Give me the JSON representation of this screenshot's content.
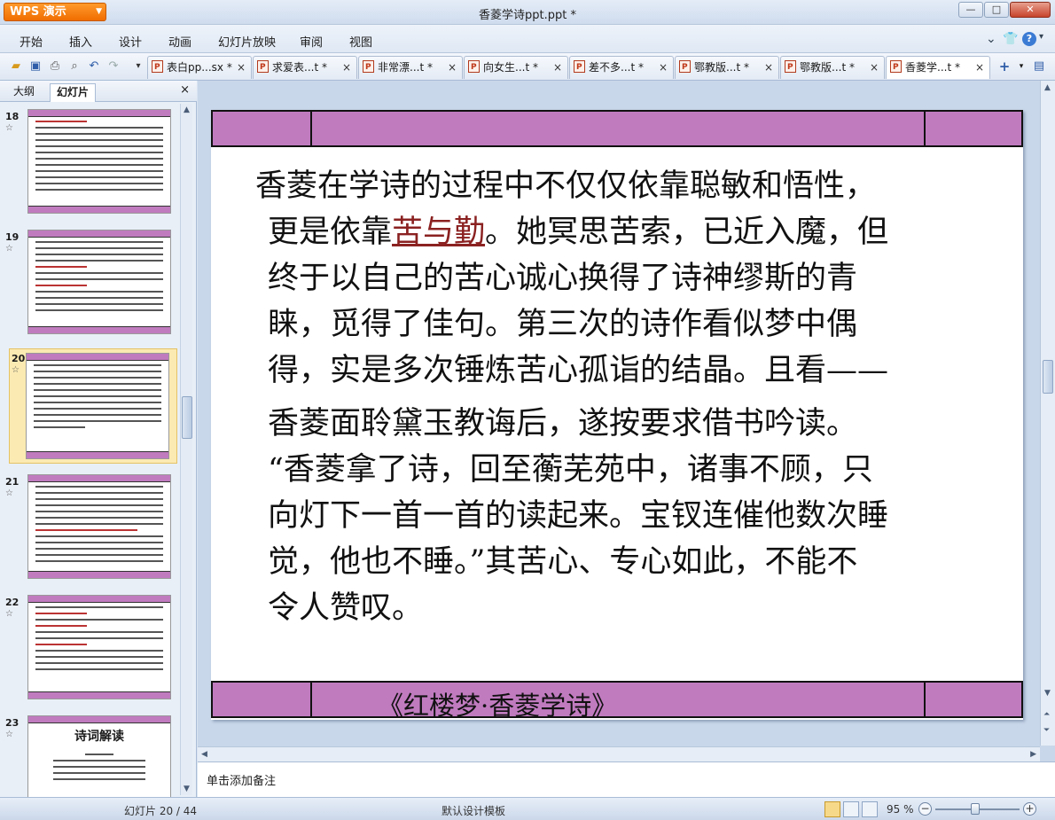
{
  "app": {
    "logo_label": "WPS 演示",
    "title": "香菱学诗ppt.ppt *"
  },
  "window_controls": {
    "minimize": "—",
    "maximize": "□",
    "close": "✕"
  },
  "menu": [
    "开始",
    "插入",
    "设计",
    "动画",
    "幻灯片放映",
    "审阅",
    "视图"
  ],
  "menu_right": {
    "dropdown": "⌄",
    "skin": "👕",
    "help": "?"
  },
  "toolbar_icons": [
    "folder-open-icon",
    "save-icon",
    "print-icon",
    "print-preview-icon",
    "undo-icon",
    "redo-icon",
    "customize-icon"
  ],
  "doc_tabs": [
    {
      "label": "表白pp...sx *"
    },
    {
      "label": "求爱表...t *"
    },
    {
      "label": "非常漂...t *"
    },
    {
      "label": "向女生...t *"
    },
    {
      "label": "差不多...t *"
    },
    {
      "label": "鄂教版...t *"
    },
    {
      "label": "鄂教版...t *"
    },
    {
      "label": "香菱学...t *"
    }
  ],
  "tab_close": "×",
  "new_tab": "+",
  "left_panel": {
    "tabs": [
      "大纲",
      "幻灯片"
    ],
    "close": "×",
    "slides": [
      {
        "number": "18",
        "star": "☆"
      },
      {
        "number": "19",
        "star": "☆"
      },
      {
        "number": "20",
        "star": "☆",
        "selected": true
      },
      {
        "number": "21",
        "star": "☆"
      },
      {
        "number": "22",
        "star": "☆"
      },
      {
        "number": "23",
        "star": "☆",
        "title": "诗词解读"
      }
    ]
  },
  "slide": {
    "lines": [
      {
        "text": "香菱在学诗的过程中不仅仅依靠聪敏和悟性，",
        "indent": false
      },
      {
        "before": "更是依靠",
        "keyword": "苦与勤",
        "after": "。她冥思苦索，已近入魔，但",
        "indent": true
      },
      {
        "text": "终于以自己的苦心诚心换得了诗神缪斯的青",
        "indent": true
      },
      {
        "text": "睐，觅得了佳句。第三次的诗作看似梦中偶",
        "indent": true
      },
      {
        "text": "得，实是多次锤炼苦心孤诣的结晶。且看——",
        "indent": true
      },
      {
        "text": "香菱面聆黛玉教诲后，遂按要求借书吟读。",
        "indent": true
      },
      {
        "text": "“香菱拿了诗，回至蘅芜苑中，诸事不顾，只",
        "indent": true
      },
      {
        "text": "向灯下一首一首的读起来。宝钗连催他数次睡",
        "indent": true
      },
      {
        "text": "觉，他也不睡。”其苦心、专心如此，不能不",
        "indent": true
      },
      {
        "text": "令人赞叹。",
        "indent": true
      }
    ],
    "footer_title": "《红楼梦·香菱学诗》",
    "band_color": "#c07bbf",
    "keyword_color": "#8b2121"
  },
  "notes": {
    "placeholder": "单击添加备注"
  },
  "status": {
    "slide_counter": "幻灯片 20 / 44",
    "template": "默认设计模板",
    "zoom": "95 %",
    "zoom_minus": "−",
    "zoom_plus": "+"
  }
}
